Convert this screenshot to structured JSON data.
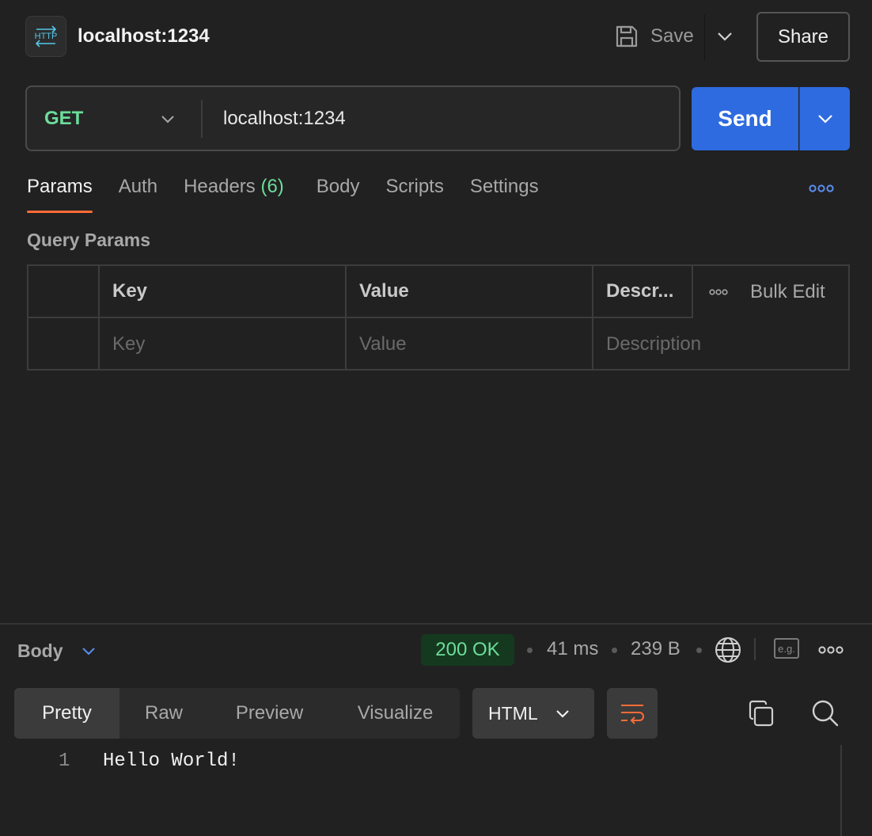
{
  "header": {
    "badge_text": "HTTP",
    "title": "localhost:1234",
    "save_label": "Save",
    "share_label": "Share"
  },
  "request": {
    "method": "GET",
    "url": "localhost:1234",
    "send_label": "Send"
  },
  "tabs": [
    {
      "label": "Params",
      "active": true
    },
    {
      "label": "Auth"
    },
    {
      "label": "Headers",
      "count": "(6)"
    },
    {
      "label": "Body"
    },
    {
      "label": "Scripts"
    },
    {
      "label": "Settings"
    }
  ],
  "query_params": {
    "title": "Query Params",
    "columns": [
      "Key",
      "Value",
      "Descr..."
    ],
    "bulk_edit_label": "Bulk Edit",
    "placeholders": [
      "Key",
      "Value",
      "Description"
    ]
  },
  "response": {
    "body_label": "Body",
    "status": "200 OK",
    "time": "41 ms",
    "size": "239 B",
    "example_label": "e.g.",
    "view_tabs": [
      "Pretty",
      "Raw",
      "Preview",
      "Visualize"
    ],
    "active_view": "Pretty",
    "format": "HTML",
    "lines": [
      {
        "number": "1",
        "text": "Hello World!"
      }
    ]
  },
  "colors": {
    "accent_orange": "#ff6c37",
    "send_blue": "#2f6be0",
    "method_green": "#6bdd9a",
    "status_bg": "#15391f"
  },
  "icons": [
    "http-icon",
    "save-icon",
    "chevron-down-icon",
    "more-icon",
    "globe-icon",
    "copy-icon",
    "search-icon",
    "wrap-lines-icon"
  ]
}
